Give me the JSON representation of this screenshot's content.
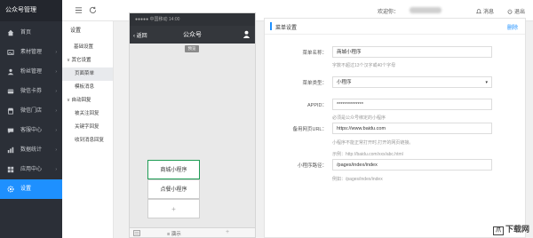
{
  "sidebar": {
    "brand": "公众号管理",
    "items": [
      {
        "label": "首页",
        "icon": "home-icon",
        "active": false
      },
      {
        "label": "素材管理",
        "icon": "image-icon",
        "active": false
      },
      {
        "label": "粉丝管理",
        "icon": "user-icon",
        "active": false
      },
      {
        "label": "微信卡券",
        "icon": "card-icon",
        "active": false
      },
      {
        "label": "微信门店",
        "icon": "store-icon",
        "active": false
      },
      {
        "label": "客服中心",
        "icon": "chat-icon",
        "active": false
      },
      {
        "label": "数据统计",
        "icon": "chart-icon",
        "active": false
      },
      {
        "label": "应用中心",
        "icon": "apps-icon",
        "active": false
      },
      {
        "label": "设置",
        "icon": "gear-icon",
        "active": true
      }
    ]
  },
  "topbar": {
    "welcome": "欢迎你：",
    "message": "消息",
    "logout": "退出"
  },
  "submenu": {
    "title": "设置",
    "basic": "基础设置",
    "group_other": "其它设置",
    "page_menu": "页面菜单",
    "template_msg": "模板消息",
    "group_auto": "自动回复",
    "follow_reply": "被关注回复",
    "keyword_reply": "关键字回复",
    "receive_reply": "收到消息回复"
  },
  "phone": {
    "status": "●●●●● 中国移动  14:00",
    "back": "返回",
    "title": "公众号",
    "preview_tag": "预览",
    "menu": [
      "商城小程序",
      "点餐小程序",
      "+"
    ],
    "keyboard_icon": "keyboard-icon",
    "bottom_label": "演示",
    "bottom_plus": "+"
  },
  "form": {
    "header_title": "菜单设置",
    "delete": "删除",
    "name_label": "菜单名称：",
    "name_value": "商城小程序",
    "name_hint": "字数不超过13个汉字或40个字母",
    "type_label": "菜单类型：",
    "type_value": "小程序",
    "appid_label": "APPID：",
    "appid_value": "**************",
    "appid_hint": "必须是公众号绑定的小程序",
    "url_label": "备用网页URL：",
    "url_value": "https://www.baidu.com",
    "url_hint1": "小程序不能正常打开时,打开的网页链接。",
    "url_hint2": "示例：http://baidu.com/xxx/abc.html",
    "path_label": "小程序路径：",
    "path_value": "/pages/index/index",
    "path_hint": "例如：/pages/index/index"
  },
  "watermark": "下载网",
  "watermark_badge": "爪"
}
